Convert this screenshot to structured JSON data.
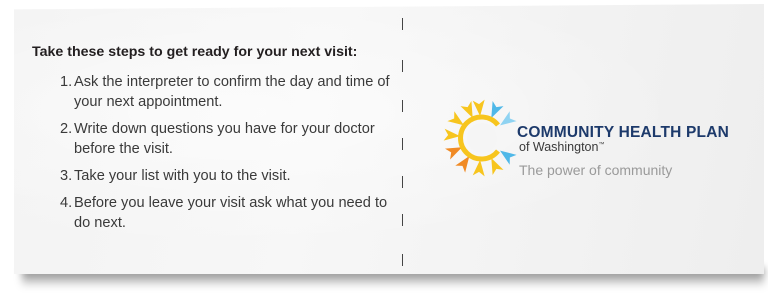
{
  "card": {
    "heading": "Take these steps to get ready for your next visit:",
    "steps": [
      {
        "number": "1.",
        "text": "Ask the interpreter to confirm the day and time of your next appointment."
      },
      {
        "number": "2.",
        "text": "Write down questions you have for your doctor before the visit."
      },
      {
        "number": "3.",
        "text": "Take your list with you to the visit."
      },
      {
        "number": "4.",
        "text": "Before you leave your visit ask what you need to do next."
      }
    ]
  },
  "brand": {
    "name": "COMMUNITY HEALTH PLAN",
    "subname": "of Washington",
    "trademark": "™",
    "tagline": "The power of community",
    "logo_icon": "sunburst-c-logo-icon",
    "colors": {
      "navy": "#1d3a6b",
      "yellow": "#f7c51e",
      "orange": "#f08a24",
      "sky_blue": "#4fb8e8",
      "light_blue": "#8fd3f2",
      "gray_text": "#9a9a9a"
    }
  }
}
